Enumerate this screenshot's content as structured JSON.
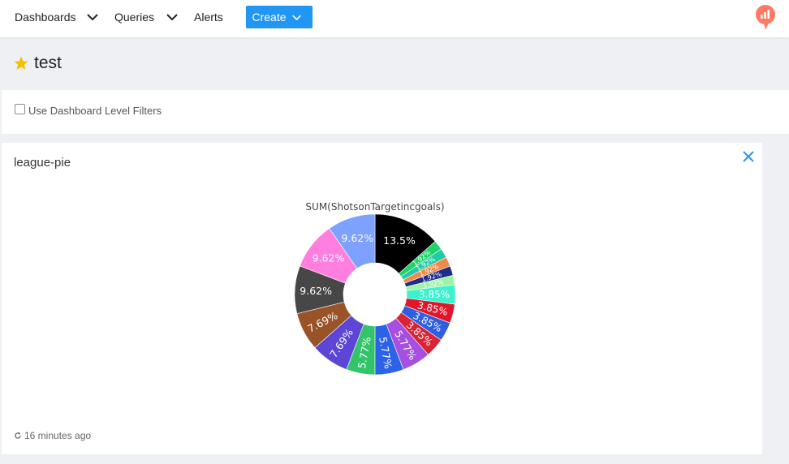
{
  "nav": {
    "dashboards": "Dashboards",
    "queries": "Queries",
    "alerts": "Alerts",
    "create": "Create",
    "logo_color": "#ff7964",
    "create_color": "#2196f3"
  },
  "page": {
    "title": "test",
    "star_color": "#f5c000"
  },
  "filters": {
    "label": "Use Dashboard Level Filters",
    "checked": false
  },
  "widget": {
    "title": "league-pie",
    "refreshed": "16 minutes ago"
  },
  "chart_data": {
    "type": "pie",
    "hole": true,
    "title": "SUM(ShotsonTargetincgoals)",
    "slices": [
      {
        "label": "13.5%",
        "value": 13.5,
        "color": "#000000"
      },
      {
        "label": "1.92%",
        "value": 1.92,
        "color": "#1fd36a"
      },
      {
        "label": "1.92%",
        "value": 1.92,
        "color": "#25c9a4"
      },
      {
        "label": "1.92%",
        "value": 1.92,
        "color": "#f08a4b"
      },
      {
        "label": "1.92%",
        "value": 1.92,
        "color": "#1f2d87"
      },
      {
        "label": "1.92%",
        "value": 1.92,
        "color": "#9df5a3"
      },
      {
        "label": "3.85%",
        "value": 3.85,
        "color": "#3ef2d0"
      },
      {
        "label": "3.85%",
        "value": 3.85,
        "color": "#e0162b"
      },
      {
        "label": "3.85%",
        "value": 3.85,
        "color": "#2f5fe0"
      },
      {
        "label": "3.85%",
        "value": 3.85,
        "color": "#d92435"
      },
      {
        "label": "5.77%",
        "value": 5.77,
        "color": "#a74fe0"
      },
      {
        "label": "5.77%",
        "value": 5.77,
        "color": "#2c62e6"
      },
      {
        "label": "5.77%",
        "value": 5.77,
        "color": "#33c46b"
      },
      {
        "label": "7.69%",
        "value": 7.69,
        "color": "#5d46d6"
      },
      {
        "label": "7.69%",
        "value": 7.69,
        "color": "#9a5228"
      },
      {
        "label": "9.62%",
        "value": 9.62,
        "color": "#474747"
      },
      {
        "label": "9.62%",
        "value": 9.62,
        "color": "#ff7ee0"
      },
      {
        "label": "9.62%",
        "value": 9.62,
        "color": "#7ea1ff"
      }
    ]
  }
}
